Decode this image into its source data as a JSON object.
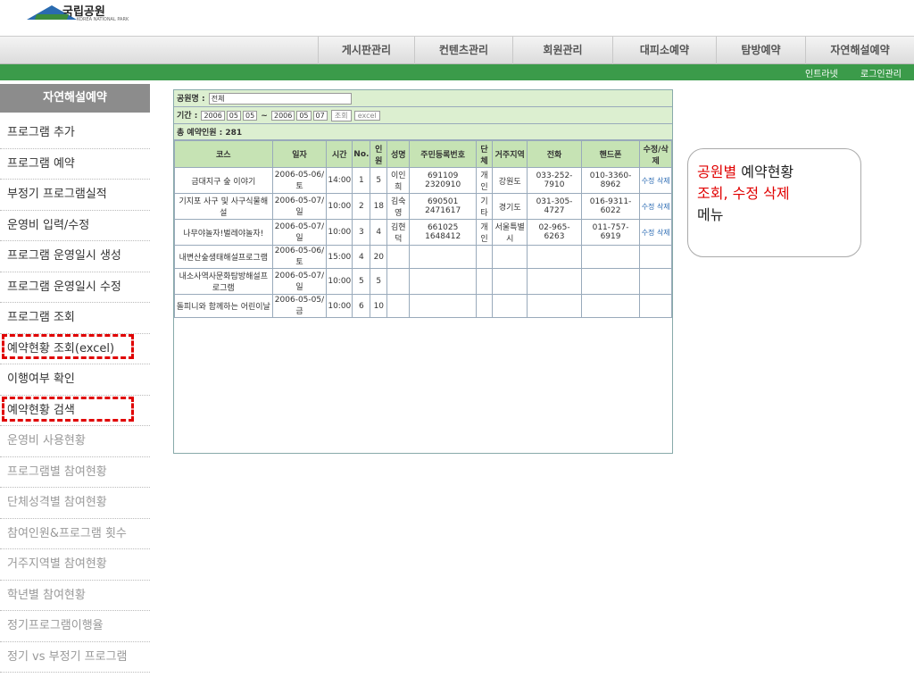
{
  "header": {
    "logo_title": "국립공원",
    "logo_sub": "KOREA NATIONAL PARK"
  },
  "topnav": [
    "게시판관리",
    "컨텐츠관리",
    "회원관리",
    "대피소예약",
    "탐방예약",
    "자연해설예약"
  ],
  "subnav": {
    "intranet": "인트라넷",
    "logout": "로그인관리"
  },
  "sidebar": {
    "title": "자연해설예약",
    "items": [
      "프로그램 추가",
      "프로그램 예약",
      "부정기 프로그램실적",
      "운영비 입력/수정",
      "프로그램 운영일시 생성",
      "프로그램 운영일시 수정",
      "프로그램 조회",
      "예약현황 조회(excel)",
      "이행여부 확인",
      "예약현황 검색",
      "운영비 사용현황",
      "프로그램별 참여현황",
      "단체성격별 참여현황",
      "참여인원&프로그램 횟수",
      "거주지역별 참여현황",
      "학년별 참여현황",
      "정기프로그램이행율",
      "정기 vs 부정기 프로그램"
    ]
  },
  "table1": {
    "park_label": "공원명 :",
    "park_value": "전체",
    "period_label": "기간 :",
    "period_from": [
      "2006",
      "05",
      "05"
    ],
    "period_to": [
      "2006",
      "05",
      "07"
    ],
    "search_button": "조회",
    "excel_button": "excel",
    "total_label": "총 예약인원 : 281",
    "headers": [
      "코스",
      "일자",
      "시간",
      "No.",
      "인원",
      "성명",
      "주민등록번호",
      "단체",
      "거주지역",
      "전화",
      "핸드폰",
      "수정/삭제"
    ],
    "rows": [
      [
        "금대지구 숲 이야기",
        "2006-05-06/토",
        "14:00",
        "1",
        "5",
        "이인희",
        "691109 2320910",
        "개인",
        "강원도",
        "033-252-7910",
        "010-3360-8962",
        "수정 삭제"
      ],
      [
        "기지포 사구 및 사구식물해설",
        "2006-05-07/일",
        "10:00",
        "2",
        "18",
        "김숙영",
        "690501 2471617",
        "기타",
        "경기도",
        "031-305-4727",
        "016-9311-6022",
        "수정 삭제"
      ],
      [
        "나무야놀자!벌레야놀자!",
        "2006-05-07/일",
        "10:00",
        "3",
        "4",
        "김현덕",
        "661025 1648412",
        "개인",
        "서울특별시",
        "02-965-6263",
        "011-757-6919",
        "수정 삭제"
      ],
      [
        "내변산숲생태해설프로그램",
        "2006-05-06/토",
        "15:00",
        "4",
        "20",
        "",
        "",
        "",
        "",
        "",
        "",
        ""
      ],
      [
        "내소사역사문화탐방해설프로그램",
        "2006-05-07/일",
        "10:00",
        "5",
        "5",
        "",
        "",
        "",
        "",
        "",
        "",
        ""
      ],
      [
        "돌피니와 함께하는 어린이날",
        "2006-05-05/금",
        "10:00",
        "6",
        "10",
        "",
        "",
        "",
        "",
        "",
        "",
        ""
      ]
    ]
  },
  "callout1": {
    "red": "공원별",
    "text1": " 예약현황",
    "red2": "조회, 수정 삭제",
    "text2": "메뉴"
  }
}
